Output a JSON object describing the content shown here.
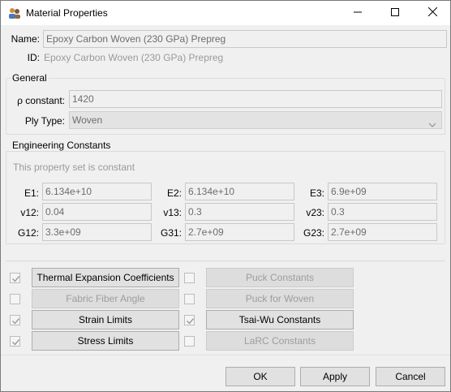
{
  "window": {
    "title": "Material Properties"
  },
  "header": {
    "name_label": "Name:",
    "name_value": "Epoxy Carbon Woven (230 GPa) Prepreg",
    "id_label": "ID:",
    "id_value": "Epoxy Carbon Woven (230 GPa) Prepreg"
  },
  "general": {
    "title": "General",
    "rho_label": "ρ constant:",
    "rho_value": "1420",
    "ply_label": "Ply Type:",
    "ply_value": "Woven"
  },
  "engineering": {
    "title": "Engineering Constants",
    "note": "This property set is constant",
    "rows": [
      [
        {
          "label": "E1:",
          "value": "6.134e+10"
        },
        {
          "label": "E2:",
          "value": "6.134e+10"
        },
        {
          "label": "E3:",
          "value": "6.9e+09"
        }
      ],
      [
        {
          "label": "v12:",
          "value": "0.04"
        },
        {
          "label": "v13:",
          "value": "0.3"
        },
        {
          "label": "v23:",
          "value": "0.3"
        }
      ],
      [
        {
          "label": "G12:",
          "value": "3.3e+09"
        },
        {
          "label": "G31:",
          "value": "2.7e+09"
        },
        {
          "label": "G23:",
          "value": "2.7e+09"
        }
      ]
    ]
  },
  "property_sets": {
    "left": [
      {
        "label": "Thermal Expansion Coefficients",
        "checked": true,
        "enabled": true
      },
      {
        "label": "Fabric Fiber Angle",
        "checked": false,
        "enabled": false
      },
      {
        "label": "Strain Limits",
        "checked": true,
        "enabled": true
      },
      {
        "label": "Stress Limits",
        "checked": true,
        "enabled": true
      }
    ],
    "right": [
      {
        "label": "Puck Constants",
        "checked": false,
        "enabled": false
      },
      {
        "label": "Puck for Woven",
        "checked": false,
        "enabled": false
      },
      {
        "label": "Tsai-Wu Constants",
        "checked": true,
        "enabled": true
      },
      {
        "label": "LaRC Constants",
        "checked": false,
        "enabled": false
      }
    ]
  },
  "footer": {
    "ok": "OK",
    "apply": "Apply",
    "cancel": "Cancel"
  },
  "icons": {
    "app": "material-properties-icon",
    "minimize": "minimize-icon",
    "maximize": "maximize-icon",
    "close": "close-icon",
    "dropdown": "chevron-down-icon",
    "check": "checkmark-icon"
  },
  "colors": {
    "window_bg": "#f0f0f0",
    "titlebar_bg": "#ffffff",
    "field_border": "#c8c8c8",
    "disabled_text": "#9d9d9d"
  }
}
